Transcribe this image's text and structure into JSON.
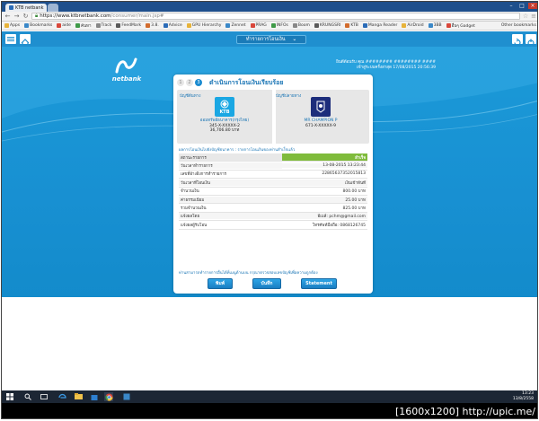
{
  "browser": {
    "tabs": [
      {
        "label": "KTB netbank"
      }
    ],
    "url_host": "https://www.ktbnetbank.com",
    "url_path": "/consumer/main.jsp#",
    "bookmarks": [
      "Apps",
      "Bookmarks",
      "aide",
      "ค้นหา",
      "Track",
      "FeedMark",
      "3.8.",
      "Advice",
      "GPU Hierarchy",
      "Zennet",
      "PRAG",
      "INFOs",
      "Boom",
      "KRUNGSRI",
      "KTB",
      "Manga Reader",
      "AirDroid",
      "3BB",
      "อื่นๆ Gadget"
    ],
    "other_bookmarks": "Other bookmarks"
  },
  "header": {
    "dropdown_label": "ทำรายการโอนเงิน",
    "dropdown_arrow": "⌄"
  },
  "brand": {
    "logo_text": "netbank"
  },
  "user": {
    "line1": "ยินดีต้อนรับ คุณ ######## ######## ####",
    "line2": "เข้าสู่ระบบครั้งล่าสุด 17/08/2015 20:56:39"
  },
  "card": {
    "steps": [
      "1",
      "2",
      "3"
    ],
    "title": "ดำเนินการโอนเงินเรียบร้อย",
    "from_heading": "บัญชีต้นทาง",
    "to_heading": "บัญชีปลายทาง",
    "from_bank": "KTB",
    "from_name": "ออมทรัพย์ธนาคาร(กรุงไทย)",
    "from_account": "345-X-XXXXX-2",
    "from_balance": "36,706.80 บาท",
    "to_name": "MR CHAMPION P",
    "to_account": "671-X-XXXXX-9",
    "note": "ผลการโอนเงินไปยังบัญชีธนาคาร : รายการโอนเงินของท่านสำเร็จแล้ว",
    "rows": [
      {
        "k": "สถานะรายการ",
        "v": "สำเร็จ"
      },
      {
        "k": "วันเวลาทำรายการ",
        "v": "13-08-2015 13:23:44"
      },
      {
        "k": "เลขที่อ้างอิงการทำรายการ",
        "v": "22865637352015813"
      },
      {
        "k": "วันเวลาที่โอนเงิน",
        "v": "เงินเข้าทันที"
      },
      {
        "k": "จำนวนเงิน",
        "v": "800.00 บาท"
      },
      {
        "k": "ค่าธรรมเนียม",
        "v": "25.00 บาท"
      },
      {
        "k": "รวมจำนวนเงิน",
        "v": "825.00 บาท"
      },
      {
        "k": "แจ้งผลโดย",
        "v": "อีเมล์: pchm@gmail.com"
      },
      {
        "k": "แจ้งผลผู้รับโอน",
        "v": "โทรศัพท์มือถือ: 0868126745"
      }
    ],
    "warning": "ท่านสามารถทำรายการอื่นได้ที่เมนูด้านบน กรุณาตรวจสอบเลขบัญชีเพื่อความถูกต้อง",
    "buttons": [
      "พิมพ์",
      "บันทึก",
      "Statement"
    ]
  },
  "taskbar": {
    "time": "13:23",
    "date": "13/8/2558"
  },
  "watermark": "[1600x1200] http://upic.me/",
  "colors": {
    "header_blue": "#1f8fcf",
    "success_green": "#7fbb3b",
    "link_blue": "#1a75b5"
  }
}
